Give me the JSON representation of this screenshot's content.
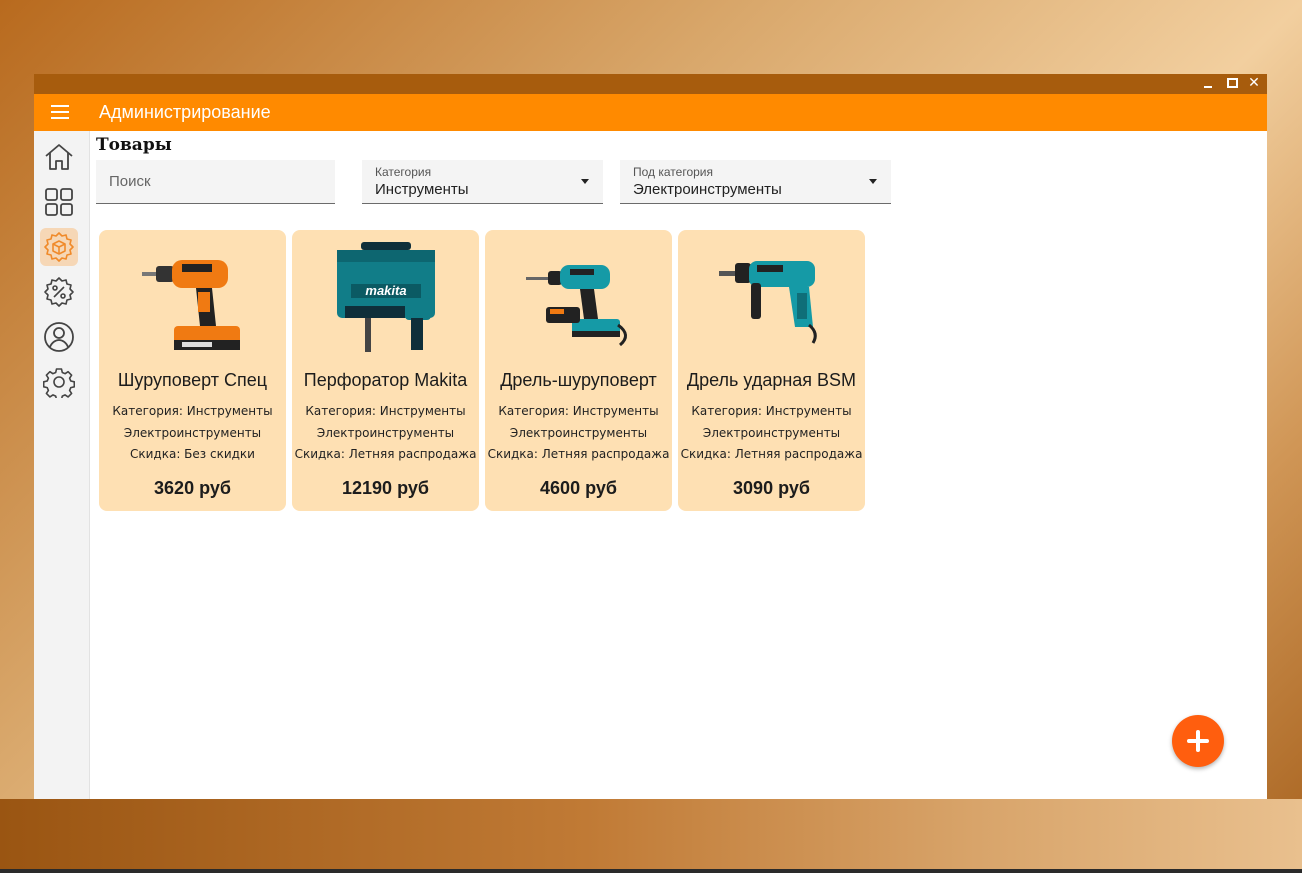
{
  "window": {
    "controls": {
      "minimize": "minimize",
      "maximize": "maximize",
      "close": "✕"
    }
  },
  "appbar": {
    "title": "Администрирование"
  },
  "sidebar": {
    "items": [
      {
        "id": "home",
        "icon": "home-icon",
        "active": false
      },
      {
        "id": "catalog",
        "icon": "grid-icon",
        "active": false
      },
      {
        "id": "products",
        "icon": "box-gear-icon",
        "active": true
      },
      {
        "id": "discounts",
        "icon": "percent-gear-icon",
        "active": false
      },
      {
        "id": "users",
        "icon": "user-icon",
        "active": false
      },
      {
        "id": "settings",
        "icon": "gear-icon",
        "active": false
      }
    ]
  },
  "page": {
    "title": "Товары",
    "search": {
      "placeholder": "Поиск",
      "value": ""
    },
    "category": {
      "label": "Категория",
      "value": "Инструменты"
    },
    "subcategory": {
      "label": "Под категория",
      "value": "Электроинструменты"
    }
  },
  "products": [
    {
      "name": "Шуруповерт Спец",
      "category": "Категория: Инструменты",
      "subcategory": "Электроинструменты",
      "discount": "Скидка: Без скидки",
      "price": "3620 руб",
      "image": "orange-cordless-drill-icon"
    },
    {
      "name": "Перфоратор Makita",
      "category": "Категория: Инструменты",
      "subcategory": "Электроинструменты",
      "discount": "Скидка: Летняя распродажа",
      "price": "12190 руб",
      "image": "makita-rotary-hammer-icon"
    },
    {
      "name": "Дрель-шуруповерт",
      "category": "Категория: Инструменты",
      "subcategory": "Электроинструменты",
      "discount": "Скидка: Летняя распродажа",
      "price": "4600 руб",
      "image": "teal-cordless-drill-icon"
    },
    {
      "name": "Дрель ударная BSM",
      "category": "Категория: Инструменты",
      "subcategory": "Электроинструменты",
      "discount": "Скидка: Летняя распродажа",
      "price": "3090 руб",
      "image": "teal-impact-drill-icon"
    }
  ],
  "fab": {
    "icon": "plus-icon"
  },
  "colors": {
    "accent": "#ff8a00",
    "titlebar": "#a75c0d",
    "card": "#fee0b3",
    "fab": "#ff5e0e"
  }
}
